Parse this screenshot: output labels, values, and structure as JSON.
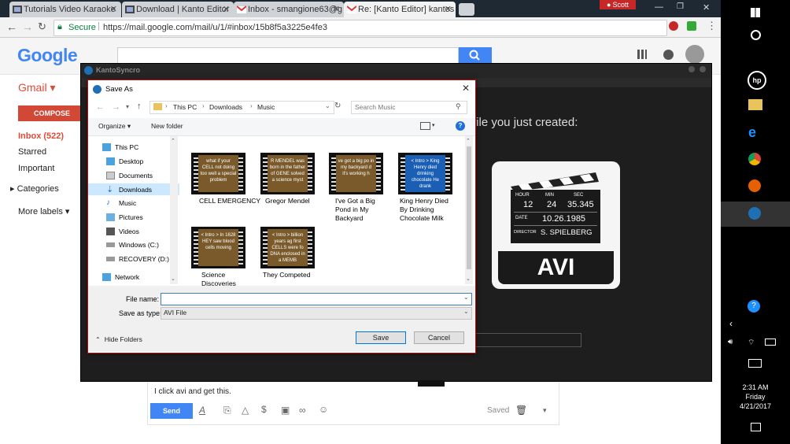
{
  "browser": {
    "tabs": [
      {
        "label": "Tutorials Video Karaoke",
        "icon": "video-icon"
      },
      {
        "label": "Download | Kanto Editor",
        "icon": "video-icon"
      },
      {
        "label": "Inbox - smangione63@g",
        "icon": "gmail-icon"
      },
      {
        "label": "Re: [Kanto Editor] kantos",
        "icon": "gmail-icon"
      }
    ],
    "user_badge": "Scott",
    "secure_label": "Secure",
    "url": "https://mail.google.com/mail/u/1/#inbox/15b8f5a3225e4fe3"
  },
  "gmail": {
    "logo": "Google",
    "app_label": "Gmail",
    "compose_label": "COMPOSE",
    "nav": [
      "Inbox (522)",
      "Starred",
      "Important",
      "Categories",
      "More labels"
    ],
    "reply_text": "I click avi and get this.",
    "send_label": "Send",
    "saved_label": "Saved"
  },
  "kanto": {
    "title": "KantoSyncro",
    "instruction": "file you just created:",
    "clapper": {
      "hour_label": "HOUR",
      "min_label": "MIN",
      "sec_label": "SEC",
      "hour": "12",
      "min": "24",
      "sec": "35.345",
      "date_label": "DATE",
      "date": "10.26.1985",
      "director_label": "DIRECTOR",
      "director": "S. SPIELBERG",
      "format": "AVI"
    }
  },
  "dialog": {
    "title": "Save As",
    "breadcrumb": [
      "This PC",
      "Downloads",
      "Music"
    ],
    "search_placeholder": "Search Music",
    "organize_label": "Organize",
    "new_folder_label": "New folder",
    "tree": [
      "This PC",
      "Desktop",
      "Documents",
      "Downloads",
      "Music",
      "Pictures",
      "Videos",
      "Windows (C:)",
      "RECOVERY (D:)",
      "Network"
    ],
    "files": [
      {
        "name": "CELL EMERGENCY",
        "thumb": "what if your CELL not doing too well a special problem"
      },
      {
        "name": "Gregor Mendel",
        "thumb": "R MENDEL was born in the father of GENE solved a science myst"
      },
      {
        "name": "I've Got a Big Pond in My Backyard",
        "thumb": "ve got a big po in my backyard d it's working h"
      },
      {
        "name": "King Henry Died By Drinking Chocolate Milk",
        "thumb": "< Intro > King Henry died drinking chocolate He drank"
      },
      {
        "name": "Science Discoveries",
        "thumb": "< Intro > In 1628 HEY saw blood cells moving"
      },
      {
        "name": "They Competed",
        "thumb": "< Intro > billion years ag first CELLS were fo DNA enclosed in a MEMB"
      }
    ],
    "file_name_label": "File name:",
    "file_name_value": "",
    "save_type_label": "Save as type:",
    "save_type_value": "AVI File",
    "hide_folders_label": "Hide Folders",
    "save_label": "Save",
    "cancel_label": "Cancel"
  },
  "taskbar": {
    "time": "2:31 AM",
    "day": "Friday",
    "date": "4/21/2017"
  }
}
